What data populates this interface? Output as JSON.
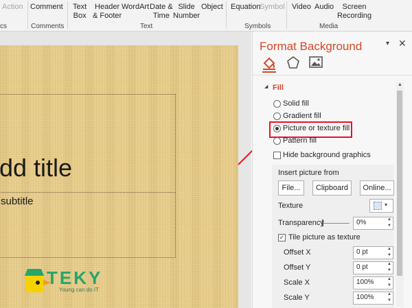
{
  "ribbon": {
    "partial_left": "Action",
    "comment": "Comment",
    "text_box": [
      "Text",
      "Box"
    ],
    "header_footer": [
      "Header",
      "& Footer"
    ],
    "wordart": "WordArt",
    "date_time": [
      "Date &",
      "Time"
    ],
    "slide_number": [
      "Slide",
      "Number"
    ],
    "object": "Object",
    "equation": "Equation",
    "symbol": "Symbol",
    "video": "Video",
    "audio": "Audio",
    "screen_recording": [
      "Screen",
      "Recording"
    ],
    "groups": {
      "partial_left": "cs",
      "comments": "Comments",
      "text": "Text",
      "symbols": "Symbols",
      "media": "Media"
    }
  },
  "slide": {
    "title_text": "dd title",
    "subtitle_text": "subtitle",
    "logo": {
      "brand": "TEKY",
      "tagline": "Young can do IT"
    }
  },
  "pane": {
    "title": "Format Background",
    "section": "Fill",
    "fill_options": [
      {
        "label": "Solid fill",
        "selected": false
      },
      {
        "label": "Gradient fill",
        "selected": false
      },
      {
        "label": "Picture or texture fill",
        "selected": true
      },
      {
        "label": "Pattern fill",
        "selected": false
      }
    ],
    "hide_background": {
      "label": "Hide background graphics",
      "checked": false
    },
    "insert_picture_from": "Insert picture from",
    "buttons": {
      "file": "File...",
      "clipboard": "Clipboard",
      "online": "Online..."
    },
    "texture_label": "Texture",
    "transparency": {
      "label": "Transparency",
      "value": "0%"
    },
    "tile": {
      "label": "Tile picture as texture",
      "checked": true
    },
    "offset_x": {
      "label": "Offset X",
      "value": "0 pt"
    },
    "offset_y": {
      "label": "Offset Y",
      "value": "0 pt"
    },
    "scale_x": {
      "label": "Scale X",
      "value": "100%"
    },
    "scale_y": {
      "label": "Scale Y",
      "value": "100%"
    }
  },
  "colors": {
    "accent": "#d24726",
    "highlight_box": "#e81123",
    "logo_green": "#27a56a"
  }
}
